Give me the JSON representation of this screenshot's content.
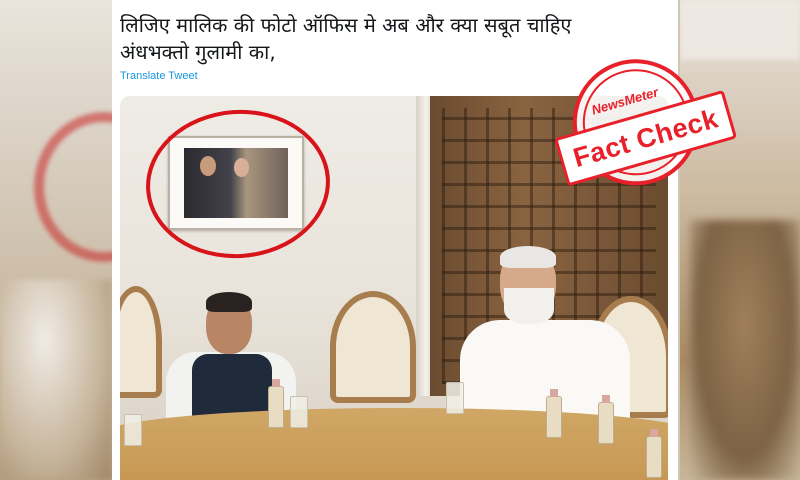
{
  "tweet": {
    "text_line1": "लिजिए मालिक की फोटो ऑफिस मे अब और क्या सबूत चाहिए",
    "text_line2": "अंधभक्तो गुलामी का,",
    "translate_label": "Translate Tweet"
  },
  "photo": {
    "description_icon": "tweet-photo"
  },
  "stamp": {
    "logo": "NewsMeter",
    "label": "Fact Check",
    "color": "#e8202a"
  },
  "colors": {
    "link": "#1b95e0",
    "text": "#14171a",
    "highlight_circle": "#d8141a"
  }
}
